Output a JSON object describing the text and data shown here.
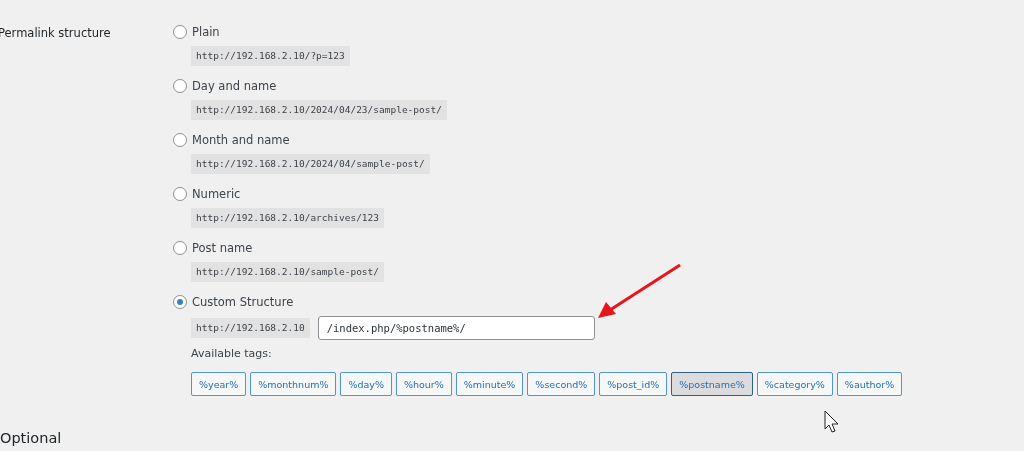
{
  "section_label": "Permalink structure",
  "options": [
    {
      "label": "Plain",
      "selected": false,
      "example": "http://192.168.2.10/?p=123"
    },
    {
      "label": "Day and name",
      "selected": false,
      "example": "http://192.168.2.10/2024/04/23/sample-post/"
    },
    {
      "label": "Month and name",
      "selected": false,
      "example": "http://192.168.2.10/2024/04/sample-post/"
    },
    {
      "label": "Numeric",
      "selected": false,
      "example": "http://192.168.2.10/archives/123"
    },
    {
      "label": "Post name",
      "selected": false,
      "example": "http://192.168.2.10/sample-post/"
    },
    {
      "label": "Custom Structure",
      "selected": true,
      "example": "http://192.168.2.10",
      "value": "/index.php/%postname%/"
    }
  ],
  "tags_label": "Available tags:",
  "tags": [
    {
      "label": "%year%",
      "selected": false
    },
    {
      "label": "%monthnum%",
      "selected": false
    },
    {
      "label": "%day%",
      "selected": false
    },
    {
      "label": "%hour%",
      "selected": false
    },
    {
      "label": "%minute%",
      "selected": false
    },
    {
      "label": "%second%",
      "selected": false
    },
    {
      "label": "%post_id%",
      "selected": false
    },
    {
      "label": "%postname%",
      "selected": true
    },
    {
      "label": "%category%",
      "selected": false
    },
    {
      "label": "%author%",
      "selected": false
    }
  ],
  "next_heading": "Optional"
}
